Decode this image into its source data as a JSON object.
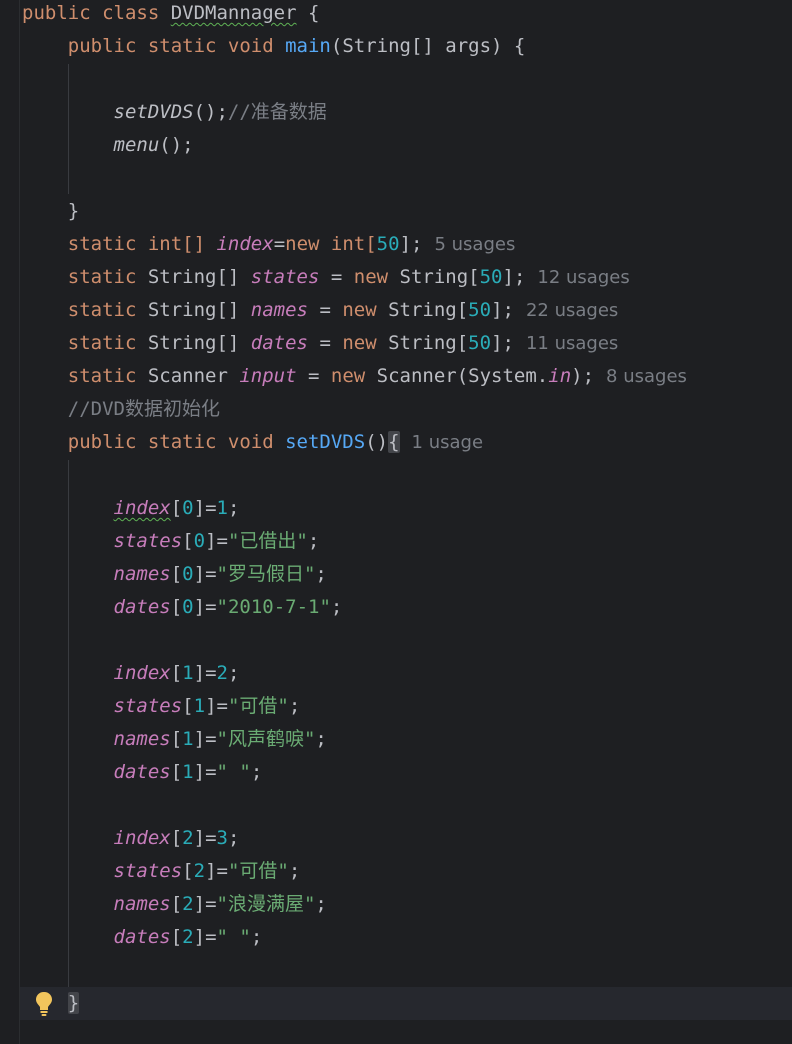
{
  "code": {
    "class_decl": {
      "kw": "public class ",
      "name": "DVDMannager",
      "rest": " {"
    },
    "main_decl": {
      "kw1": "public static void ",
      "name": "main",
      "rest": "(String[] args) {"
    },
    "call_setdvds": {
      "name": "setDVDS",
      "rest": "();",
      "comment": "//准备数据"
    },
    "call_menu": {
      "name": "menu",
      "rest": "();"
    },
    "close_brace": "}",
    "fields": [
      {
        "kw": "static ",
        "type": "int[] ",
        "name": "index",
        "eq": "=",
        "new": "new ",
        "type2": "int[",
        "size": "50",
        "end": "];",
        "usages": "5 usages"
      },
      {
        "kw": "static ",
        "type": "String[] ",
        "name": "states",
        "eq": " = ",
        "new": "new ",
        "type2": "String[",
        "size": "50",
        "end": "];",
        "usages": "12 usages"
      },
      {
        "kw": "static ",
        "type": "String[] ",
        "name": "names",
        "eq": " = ",
        "new": "new ",
        "type2": "String[",
        "size": "50",
        "end": "];",
        "usages": "22 usages"
      },
      {
        "kw": "static ",
        "type": "String[] ",
        "name": "dates",
        "eq": " = ",
        "new": "new ",
        "type2": "String[",
        "size": "50",
        "end": "];",
        "usages": "11 usages"
      }
    ],
    "scanner_field": {
      "kw": "static ",
      "type": "Scanner ",
      "name": "input",
      "eq": " = ",
      "new": "new ",
      "ctor": "Scanner(System.",
      "in": "in",
      "end": ");",
      "usages": "8 usages"
    },
    "dvd_comment": "//DVD数据初始化",
    "setdvds_decl": {
      "kw": "public static void ",
      "name": "setDVDS",
      "paren": "()",
      "brace": "{",
      "usages": "1 usage"
    },
    "assignments": [
      {
        "field": "index",
        "idx": "0",
        "mid": "]=",
        "value": "1",
        "is_num": true
      },
      {
        "field": "states",
        "idx": "0",
        "mid": "]=",
        "value": "\"已借出\"",
        "is_num": false
      },
      {
        "field": "names",
        "idx": "0",
        "mid": "]=",
        "value": "\"罗马假日\"",
        "is_num": false
      },
      {
        "field": "dates",
        "idx": "0",
        "mid": "]=",
        "value": "\"2010-7-1\"",
        "is_num": false
      },
      {
        "field": "index",
        "idx": "1",
        "mid": "]=",
        "value": "2",
        "is_num": true
      },
      {
        "field": "states",
        "idx": "1",
        "mid": "]=",
        "value": "\"可借\"",
        "is_num": false
      },
      {
        "field": "names",
        "idx": "1",
        "mid": "]=",
        "value": "\"风声鹤唳\"",
        "is_num": false
      },
      {
        "field": "dates",
        "idx": "1",
        "mid": "]=",
        "value": "\" \"",
        "is_num": false
      },
      {
        "field": "index",
        "idx": "2",
        "mid": "]=",
        "value": "3",
        "is_num": true
      },
      {
        "field": "states",
        "idx": "2",
        "mid": "]=",
        "value": "\"可借\"",
        "is_num": false
      },
      {
        "field": "names",
        "idx": "2",
        "mid": "]=",
        "value": "\"浪漫满屋\"",
        "is_num": false
      },
      {
        "field": "dates",
        "idx": "2",
        "mid": "]=",
        "value": "\" \"",
        "is_num": false
      }
    ],
    "open_bracket": "[",
    "semicolon": ";",
    "final_brace": "}"
  },
  "icons": {
    "intention": "lightbulb-icon"
  },
  "colors": {
    "background": "#1e1f22",
    "keyword": "#cf8e6d",
    "function": "#56a8f5",
    "field": "#c77dbb",
    "number": "#2aacb8",
    "string": "#6aab73",
    "comment": "#7a7e85",
    "bulb": "#f2c55c"
  }
}
